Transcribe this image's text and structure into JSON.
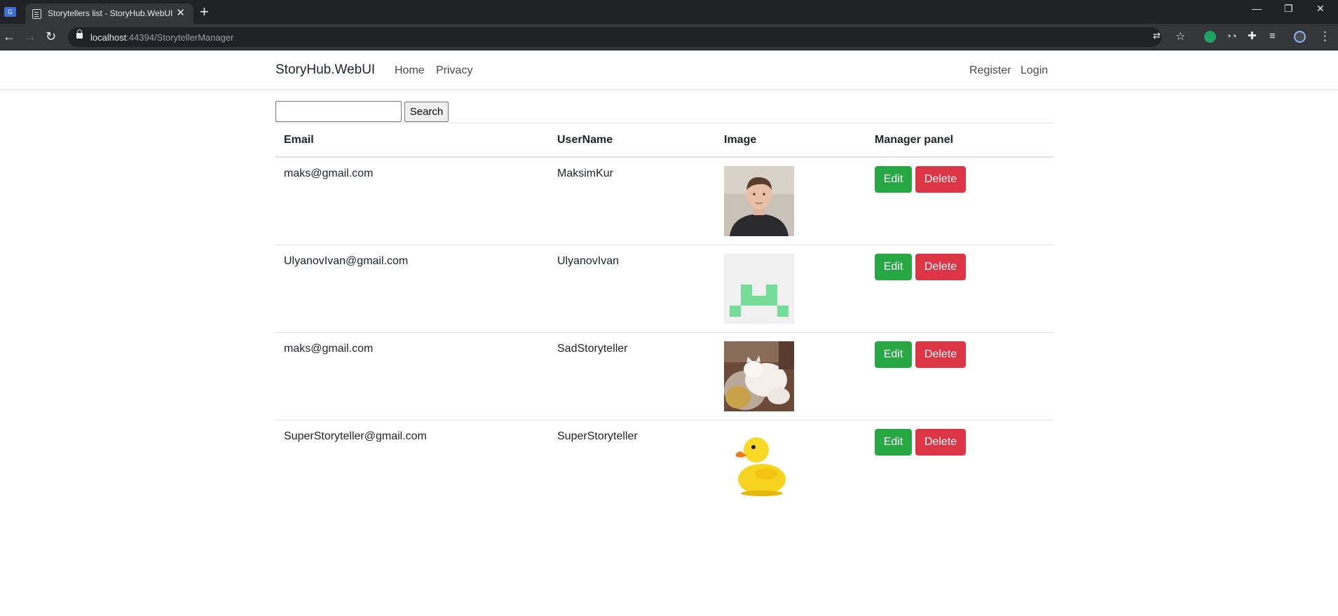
{
  "browser": {
    "tab_title": "Storytellers list - StoryHub.WebUI",
    "url_host": "localhost",
    "url_rest": ":44394/StorytellerManager",
    "icons": [
      "translate-icon",
      "star-icon",
      "extension-icon",
      "reading-list-icon",
      "profile-icon",
      "menu-icon"
    ]
  },
  "navbar": {
    "brand": "StoryHub.WebUI",
    "links": [
      {
        "label": "Home"
      },
      {
        "label": "Privacy"
      }
    ],
    "right_links": [
      {
        "label": "Register"
      },
      {
        "label": "Login"
      }
    ]
  },
  "search": {
    "value": "",
    "button_label": "Search"
  },
  "table": {
    "headers": {
      "email": "Email",
      "username": "UserName",
      "image": "Image",
      "manager": "Manager panel"
    },
    "rows": [
      {
        "email": "maks@gmail.com",
        "username": "MaksimKur",
        "image": "photo-man"
      },
      {
        "email": "UlyanovIvan@gmail.com",
        "username": "UlyanovIvan",
        "image": "identicon-green"
      },
      {
        "email": "maks@gmail.com",
        "username": "SadStoryteller",
        "image": "photo-cat"
      },
      {
        "email": "SuperStoryteller@gmail.com",
        "username": "SuperStoryteller",
        "image": "rubber-duck"
      }
    ],
    "edit_label": "Edit",
    "delete_label": "Delete"
  },
  "colors": {
    "edit": "#28a745",
    "delete": "#dc3545",
    "chrome_dark": "#202124",
    "chrome_toolbar": "#35363a"
  }
}
